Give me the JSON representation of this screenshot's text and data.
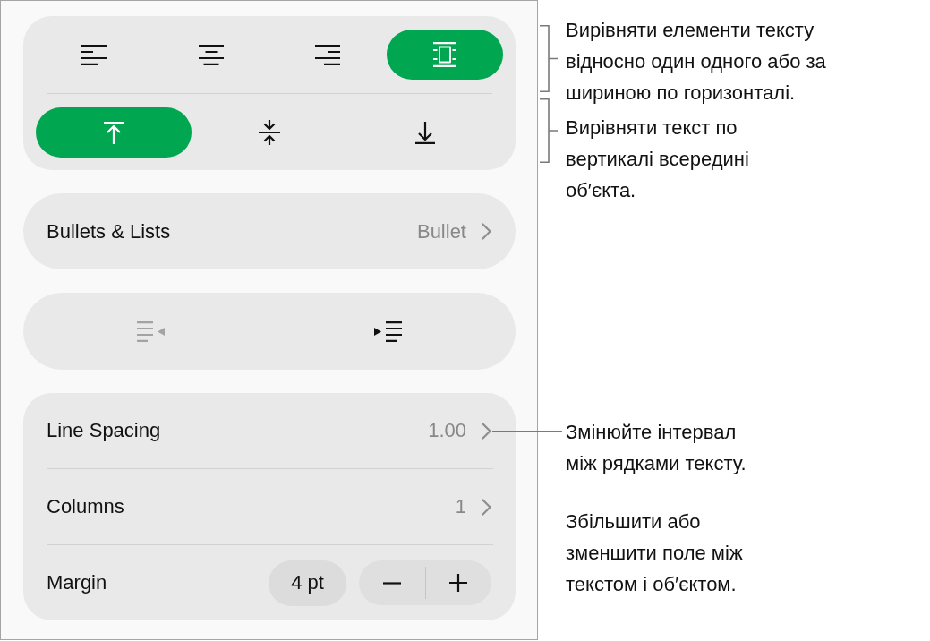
{
  "horizontal_alignment": [
    {
      "kind": "left",
      "selected": false
    },
    {
      "kind": "center",
      "selected": false
    },
    {
      "kind": "right",
      "selected": false
    },
    {
      "kind": "justify",
      "selected": true
    }
  ],
  "vertical_alignment": [
    {
      "kind": "top",
      "selected": true
    },
    {
      "kind": "middle",
      "selected": false
    },
    {
      "kind": "bottom",
      "selected": false
    }
  ],
  "bullets": {
    "label": "Bullets & Lists",
    "value": "Bullet"
  },
  "indent_buttons": [
    {
      "kind": "decrease",
      "disabled": true
    },
    {
      "kind": "increase",
      "disabled": false
    }
  ],
  "spacing_rows": [
    {
      "kind": "disclosure",
      "label": "Line Spacing",
      "value": "1.00"
    },
    {
      "kind": "disclosure",
      "label": "Columns",
      "value": "1"
    },
    {
      "kind": "stepper",
      "label": "Margin",
      "value": "4 pt"
    }
  ],
  "callouts": [
    {
      "kind": "bracket",
      "text": "Вирівняти елементи тексту\nвідносно один одного або за\nшириною по горизонталі."
    },
    {
      "kind": "bracket",
      "text": "Вирівняти текст по\nвертикалі всередині\nоб′єкта."
    },
    {
      "kind": "leader",
      "text": "Змінюйте інтервал\nміж рядками тексту."
    },
    {
      "kind": "leader",
      "text": "Збільшити або\nзменшити поле між\nтекстом і об′єктом."
    }
  ]
}
